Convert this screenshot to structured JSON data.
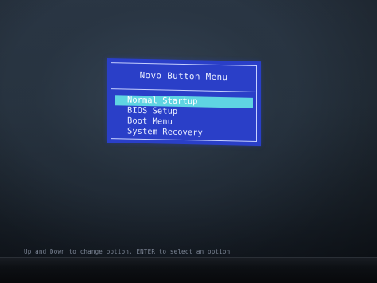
{
  "menu": {
    "title": "Novo Button Menu",
    "items": [
      {
        "label": "Normal Startup",
        "selected": true
      },
      {
        "label": "BIOS Setup",
        "selected": false
      },
      {
        "label": "Boot Menu",
        "selected": false
      },
      {
        "label": "System Recovery",
        "selected": false
      }
    ]
  },
  "footer": {
    "hint": "Up and Down to change option, ENTER to select an option"
  },
  "colors": {
    "menu_background": "#2a3fc8",
    "selection_highlight": "#5fd4e2",
    "menu_text": "#e6ebff",
    "screen_background": "#27333f"
  }
}
